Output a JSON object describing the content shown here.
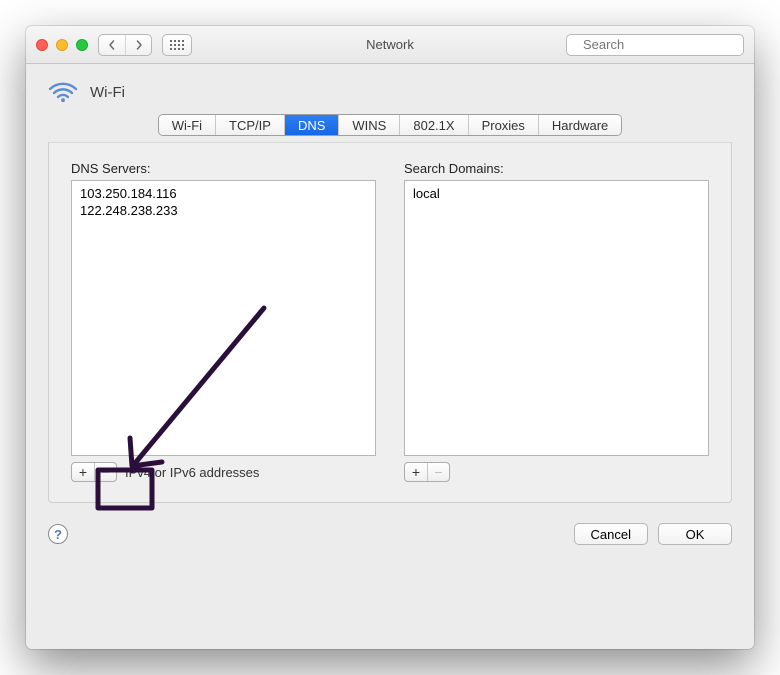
{
  "window": {
    "title": "Network",
    "search_placeholder": "Search"
  },
  "header": {
    "interface_name": "Wi-Fi",
    "icon": "wifi-icon"
  },
  "tabs": [
    {
      "id": "wifi",
      "label": "Wi-Fi",
      "selected": false
    },
    {
      "id": "tcpip",
      "label": "TCP/IP",
      "selected": false
    },
    {
      "id": "dns",
      "label": "DNS",
      "selected": true
    },
    {
      "id": "wins",
      "label": "WINS",
      "selected": false
    },
    {
      "id": "8021x",
      "label": "802.1X",
      "selected": false
    },
    {
      "id": "proxies",
      "label": "Proxies",
      "selected": false
    },
    {
      "id": "hardware",
      "label": "Hardware",
      "selected": false
    }
  ],
  "dns": {
    "servers_label": "DNS Servers:",
    "servers": [
      "103.250.184.116",
      "122.248.238.233"
    ],
    "hint": "IPv4 or IPv6 addresses",
    "add_label": "+",
    "remove_label": "−",
    "remove_enabled": false,
    "search_domains_label": "Search Domains:",
    "search_domains": [
      "local"
    ],
    "sd_add_label": "+",
    "sd_remove_label": "−",
    "sd_remove_enabled": false
  },
  "footer": {
    "help_label": "?",
    "cancel_label": "Cancel",
    "ok_label": "OK"
  },
  "annotation": {
    "color": "#2a0f3b",
    "target": "dns-add-button"
  }
}
